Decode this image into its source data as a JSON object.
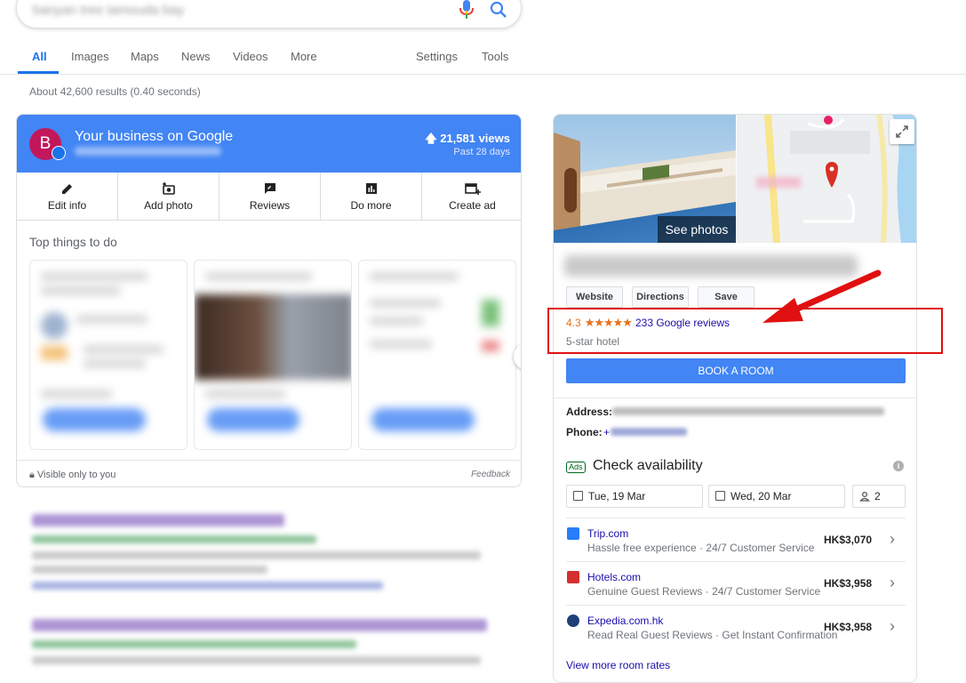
{
  "search": {
    "query": "banyan tree tamouda bay"
  },
  "tabs": [
    {
      "label": "All"
    },
    {
      "label": "Images"
    },
    {
      "label": "Maps"
    },
    {
      "label": "News"
    },
    {
      "label": "Videos"
    },
    {
      "label": "More"
    },
    {
      "label": "Settings"
    },
    {
      "label": "Tools"
    }
  ],
  "stats": "About 42,600 results (0.40 seconds)",
  "business": {
    "avatar_letter": "B",
    "title": "Your business on Google",
    "views": "21,581 views",
    "views_period": "Past 28 days",
    "actions": [
      {
        "label": "Edit info",
        "icon": "pencil-icon"
      },
      {
        "label": "Add photo",
        "icon": "add-photo-icon"
      },
      {
        "label": "Reviews",
        "icon": "reviews-icon"
      },
      {
        "label": "Do more",
        "icon": "chart-icon"
      },
      {
        "label": "Create ad",
        "icon": "create-ad-icon"
      }
    ],
    "top_things": "Top things to do",
    "visible_only": "Visible only to you",
    "feedback": "Feedback"
  },
  "panel": {
    "see_photos": "See photos",
    "buttons": {
      "website": "Website",
      "directions": "Directions",
      "save": "Save"
    },
    "rating": "4.3",
    "stars": "★★★★★",
    "reviews": "233 Google reviews",
    "hotel_type": "5-star hotel",
    "book_label": "BOOK A ROOM",
    "address_label": "Address:",
    "phone_label": "Phone:",
    "phone_prefix": "+",
    "ads_badge": "Ads",
    "check_availability": "Check availability",
    "checkin": "Tue, 19 Mar",
    "checkout": "Wed, 20 Mar",
    "guests": "2",
    "offers": [
      {
        "site": "Trip.com",
        "desc": "Hassle free experience · 24/7 Customer Service",
        "price": "HK$3,070",
        "color": "#287dfa"
      },
      {
        "site": "Hotels.com",
        "desc": "Genuine Guest Reviews · 24/7 Customer Service",
        "price": "HK$3,958",
        "color": "#d32f2f"
      },
      {
        "site": "Expedia.com.hk",
        "desc": "Read Real Guest Reviews · Get Instant Confirmation",
        "price": "HK$3,958",
        "color": "#1f3f7a"
      }
    ],
    "view_more": "View more room rates"
  },
  "colors": {
    "accent": "#4285f4",
    "link": "#1a0dab",
    "star": "#e7711b",
    "annotation": "#e01010"
  }
}
